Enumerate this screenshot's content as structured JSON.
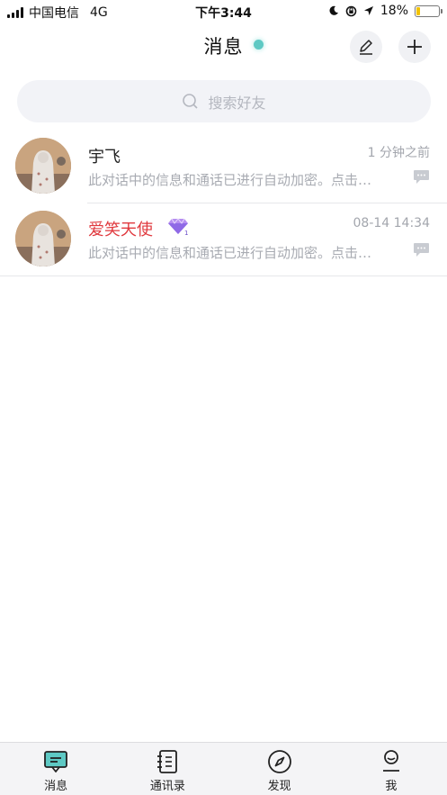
{
  "status_bar": {
    "carrier": "中国电信",
    "network": "4G",
    "time": "下午3:44",
    "battery_percent": "18%",
    "battery_level": 0.18,
    "battery_color": "#f2c200"
  },
  "header": {
    "title": "消息",
    "online_dot_color": "#5ec9c4",
    "edit_icon": "pencil-icon",
    "add_icon": "plus-icon"
  },
  "search": {
    "placeholder": "搜索好友",
    "icon": "search-icon"
  },
  "conversations": [
    {
      "name": "宇飞",
      "time": "1 分钟之前",
      "preview": "此对话中的信息和通话已进行自动加密。点击…",
      "name_color": "#222222"
    },
    {
      "name": "爱笑天使",
      "badge_icon": "diamond-icon",
      "time": "08-14 14:34",
      "preview": "此对话中的信息和通话已进行自动加密。点击…",
      "name_color": "#e0393e"
    }
  ],
  "tabbar": {
    "items": [
      {
        "label": "消息",
        "icon": "chat-icon"
      },
      {
        "label": "通讯录",
        "icon": "contacts-icon"
      },
      {
        "label": "发现",
        "icon": "compass-icon"
      },
      {
        "label": "我",
        "icon": "profile-icon"
      }
    ]
  }
}
